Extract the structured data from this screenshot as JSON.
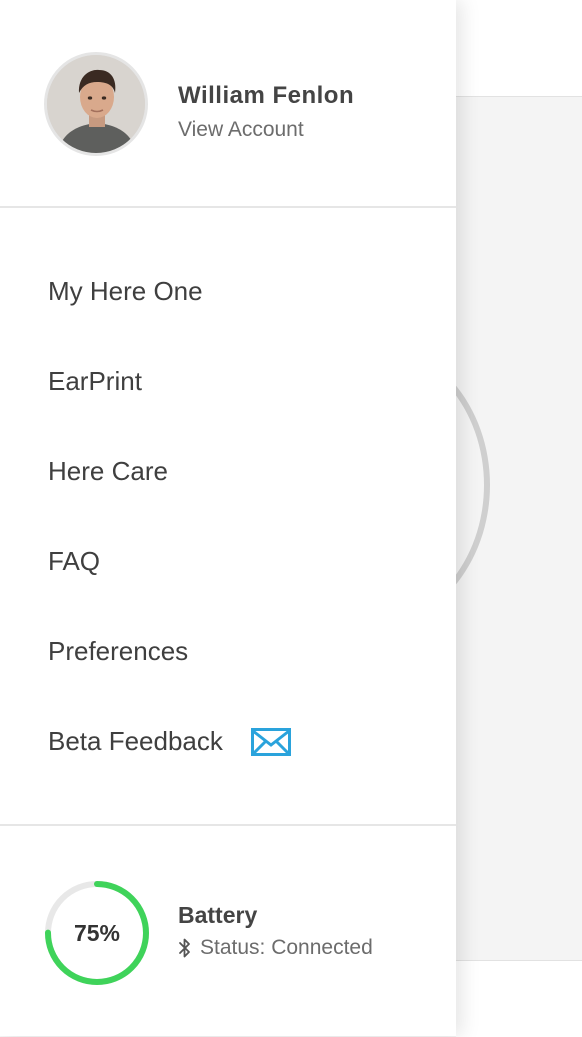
{
  "profile": {
    "name": "William Fenlon",
    "view_account": "View Account"
  },
  "menu": {
    "items": [
      {
        "label": "My Here One"
      },
      {
        "label": "EarPrint"
      },
      {
        "label": "Here Care"
      },
      {
        "label": "FAQ"
      },
      {
        "label": "Preferences"
      },
      {
        "label": "Beta Feedback",
        "icon": "mail-icon"
      }
    ]
  },
  "battery": {
    "percent_text": "75%",
    "level": 0.75,
    "title": "Battery",
    "status": "Status: Connected",
    "status_icon": "bluetooth-icon"
  },
  "colors": {
    "battery_fill": "#3fd35a",
    "battery_track": "#e8e8e8",
    "mail_icon": "#2aa3dc"
  }
}
